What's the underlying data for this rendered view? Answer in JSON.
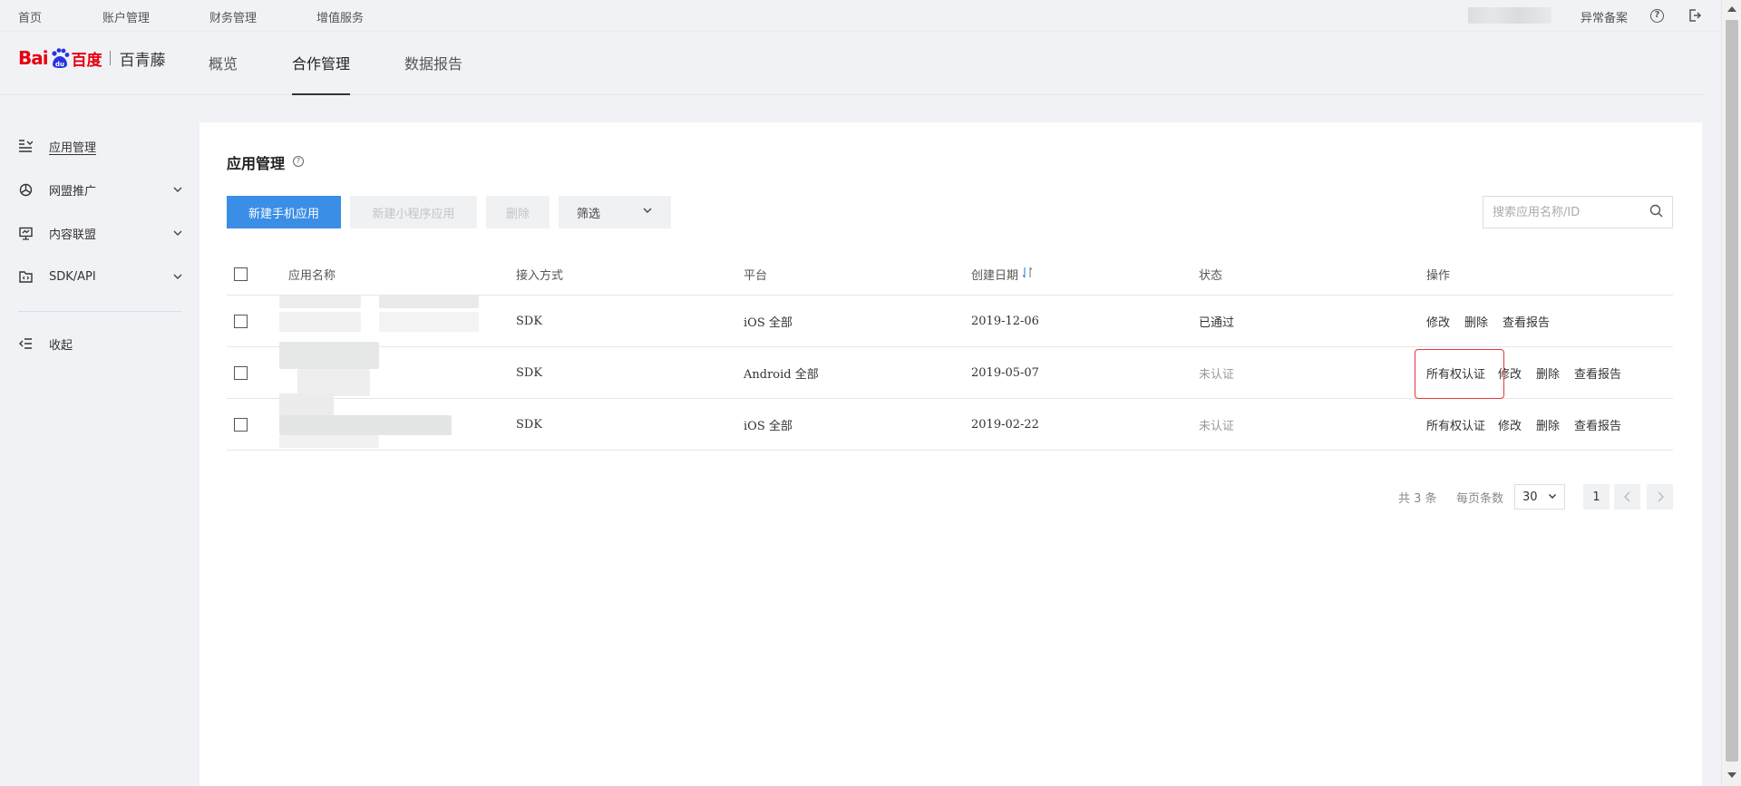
{
  "topbar": {
    "links": [
      "首页",
      "账户管理",
      "财务管理",
      "增值服务"
    ],
    "anomaly_label": "异常备案",
    "help_icon": "question-circle-icon",
    "logout_icon": "logout-icon"
  },
  "header": {
    "logo_text": "Bai",
    "logo_cn": "百度",
    "product_name": "百青藤",
    "tabs": [
      "概览",
      "合作管理",
      "数据报告"
    ],
    "active_tab": "合作管理"
  },
  "sidebar": {
    "items": [
      {
        "label": "应用管理",
        "icon": "list-icon",
        "active": true
      },
      {
        "label": "网盟推广",
        "icon": "network-icon",
        "expandable": true
      },
      {
        "label": "内容联盟",
        "icon": "monitor-icon",
        "expandable": true
      },
      {
        "label": "SDK/API",
        "icon": "folder-icon",
        "expandable": true
      }
    ],
    "collapse_label": "收起"
  },
  "main": {
    "title": "应用管理",
    "buttons": {
      "new_mobile_app": "新建手机应用",
      "new_mini_program": "新建小程序应用",
      "delete": "删除",
      "filter": "筛选"
    },
    "search": {
      "placeholder": "搜索应用名称/ID"
    },
    "table": {
      "headers": [
        "应用名称",
        "接入方式",
        "平台",
        "创建日期",
        "状态",
        "操作"
      ],
      "rows": [
        {
          "access": "SDK",
          "platform": "iOS 全部",
          "date": "2019-12-06",
          "status": "已通过",
          "ops": [
            "修改",
            "删除",
            "查看报告"
          ]
        },
        {
          "access": "SDK",
          "platform": "Android 全部",
          "date": "2019-05-07",
          "status": "未认证",
          "ops": [
            "所有权认证",
            "修改",
            "删除",
            "查看报告"
          ]
        },
        {
          "access": "SDK",
          "platform": "iOS 全部",
          "date": "2019-02-22",
          "status": "未认证",
          "ops": [
            "所有权认证",
            "修改",
            "删除",
            "查看报告"
          ]
        }
      ]
    },
    "pagination": {
      "total_text": "共 3 条",
      "page_size_label": "每页条数",
      "page_size": "30",
      "current_page": "1"
    }
  },
  "colors": {
    "primary": "#3a8ee6",
    "highlight": "#e53935",
    "logo_red": "#e60012",
    "logo_blue": "#2932e1"
  }
}
